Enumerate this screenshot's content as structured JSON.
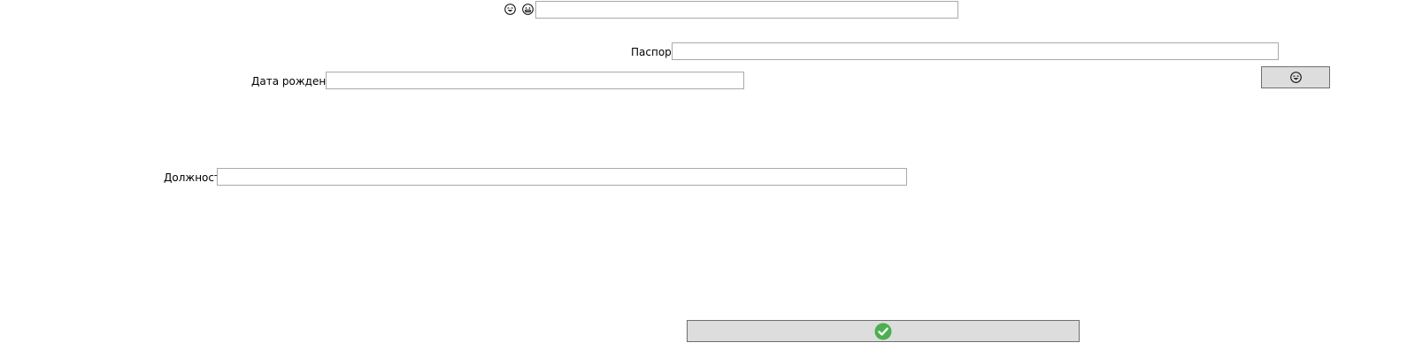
{
  "top_row": {
    "icon_left": "smiling-face-icon",
    "icon_right": "grinning-face-icon",
    "input_value": ""
  },
  "passport": {
    "label": "Паспорт",
    "value": ""
  },
  "birth_date": {
    "label": "Дата рождения",
    "value": ""
  },
  "position": {
    "label": "Должность",
    "value": ""
  },
  "face_button": {
    "icon": "smiling-face-icon"
  },
  "confirm_button": {
    "icon": "green-checkmark-icon",
    "color": "#4caf50"
  }
}
